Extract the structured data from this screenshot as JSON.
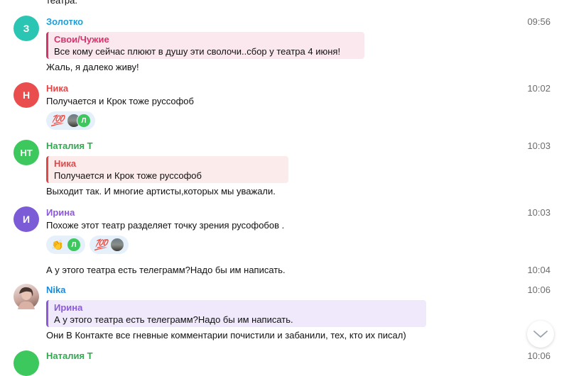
{
  "top_fragment": "театра.",
  "messages": [
    {
      "sender": "Золотко",
      "sender_color": "#1a9fd9",
      "avatar_letter": "З",
      "avatar_color": "#2bc5b4",
      "time": "09:56",
      "quote": {
        "name": "Свои/Чужие",
        "text": "Все кому сейчас плюют в душу эти  сволочи..сбор  у театра 4 июня!",
        "color": "#d6336c",
        "bg": "#fbe8ee"
      },
      "text": "Жаль, я далеко живу!"
    },
    {
      "sender": "Ника",
      "sender_color": "#e04848",
      "avatar_letter": "Н",
      "avatar_color": "#ea4d4d",
      "time": "10:02",
      "text": "Получается и Крок тоже руссофоб",
      "reactions": [
        {
          "emoji": "💯",
          "avatar_letter": "Л"
        }
      ]
    },
    {
      "sender": "Наталия Т",
      "sender_color": "#2fab4f",
      "avatar_letter": "НТ",
      "avatar_color": "#3cc85d",
      "time": "10:03",
      "quote": {
        "name": "Ника",
        "text": "Получается и Крок тоже руссофоб",
        "color": "#e04848",
        "bg": "#fcebeb"
      },
      "text": "Выходит так. И многие артисты,которых мы уважали."
    },
    {
      "sender": "Ирина",
      "sender_color": "#8c59d9",
      "avatar_letter": "И",
      "avatar_color": "#7b5bd6",
      "time": "10:03",
      "text": "Похоже этот театр разделяет точку зрения русофобов .",
      "reactions": [
        {
          "emoji": "👏",
          "avatar_letter": "Л"
        },
        {
          "emoji": "💯",
          "avatar_letter": ""
        }
      ]
    },
    {
      "time": "10:04",
      "text": "А у этого театра есть телеграмм?Надо бы им написать."
    },
    {
      "sender": "Nika",
      "sender_color": "#1a8ad9",
      "time": "10:06",
      "quote": {
        "name": "Ирина",
        "text": "А у этого театра есть телеграмм?Надо бы им написать.",
        "color": "#8c59d9",
        "bg": "#efe9fb"
      },
      "text": "Они В Контакте все гневные комментарии почистили и забанили, тех, кто их писал)"
    },
    {
      "sender": "Наталия Т",
      "sender_color": "#2fab4f",
      "avatar_color": "#3cc85d",
      "time": "10:06"
    }
  ],
  "colors": {
    "reaction_bg": "#e6f0fb",
    "mini_avatar_green": "#3cc85d"
  },
  "icons": {
    "scroll_down": "chevron-down-icon",
    "reaction_100": "hundred-points-emoji",
    "reaction_clap": "clapping-hands-emoji"
  }
}
